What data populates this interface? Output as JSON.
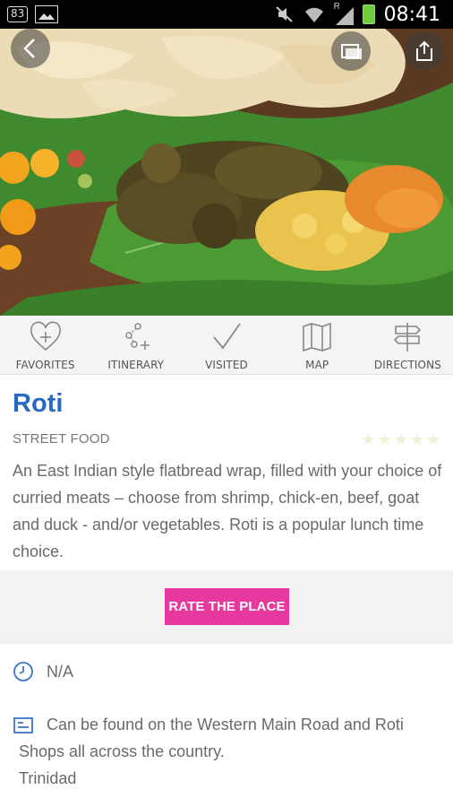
{
  "status_bar": {
    "notification_badge": "83",
    "time": "08:41",
    "signal_label": "R"
  },
  "hero": {
    "icons": [
      "back-icon",
      "gallery-icon",
      "share-icon"
    ]
  },
  "actions": [
    {
      "label": "FAVORITES",
      "icon": "heart-plus-icon"
    },
    {
      "label": "ITINERARY",
      "icon": "itinerary-icon"
    },
    {
      "label": "VISITED",
      "icon": "checkmark-icon"
    },
    {
      "label": "MAP",
      "icon": "map-icon"
    },
    {
      "label": "DIRECTIONS",
      "icon": "signpost-icon"
    }
  ],
  "place": {
    "title": "Roti",
    "category": "STREET FOOD",
    "rating": 0,
    "description": "An East Indian style flatbread wrap, filled with your choice of curried meats – choose from shrimp, chick-en, beef, goat and duck - and/or vegetables. Roti is a popular lunch time choice."
  },
  "rate_button": "RATE THE PLACE",
  "hours": "N/A",
  "location": {
    "text": "Can be found on the Western Main Road and Roti Shops all across the country.",
    "region": "Trinidad"
  },
  "colors": {
    "accent_blue": "#2769c5",
    "rate_pink": "#e6389f",
    "icon_blue": "#3b74c9"
  }
}
